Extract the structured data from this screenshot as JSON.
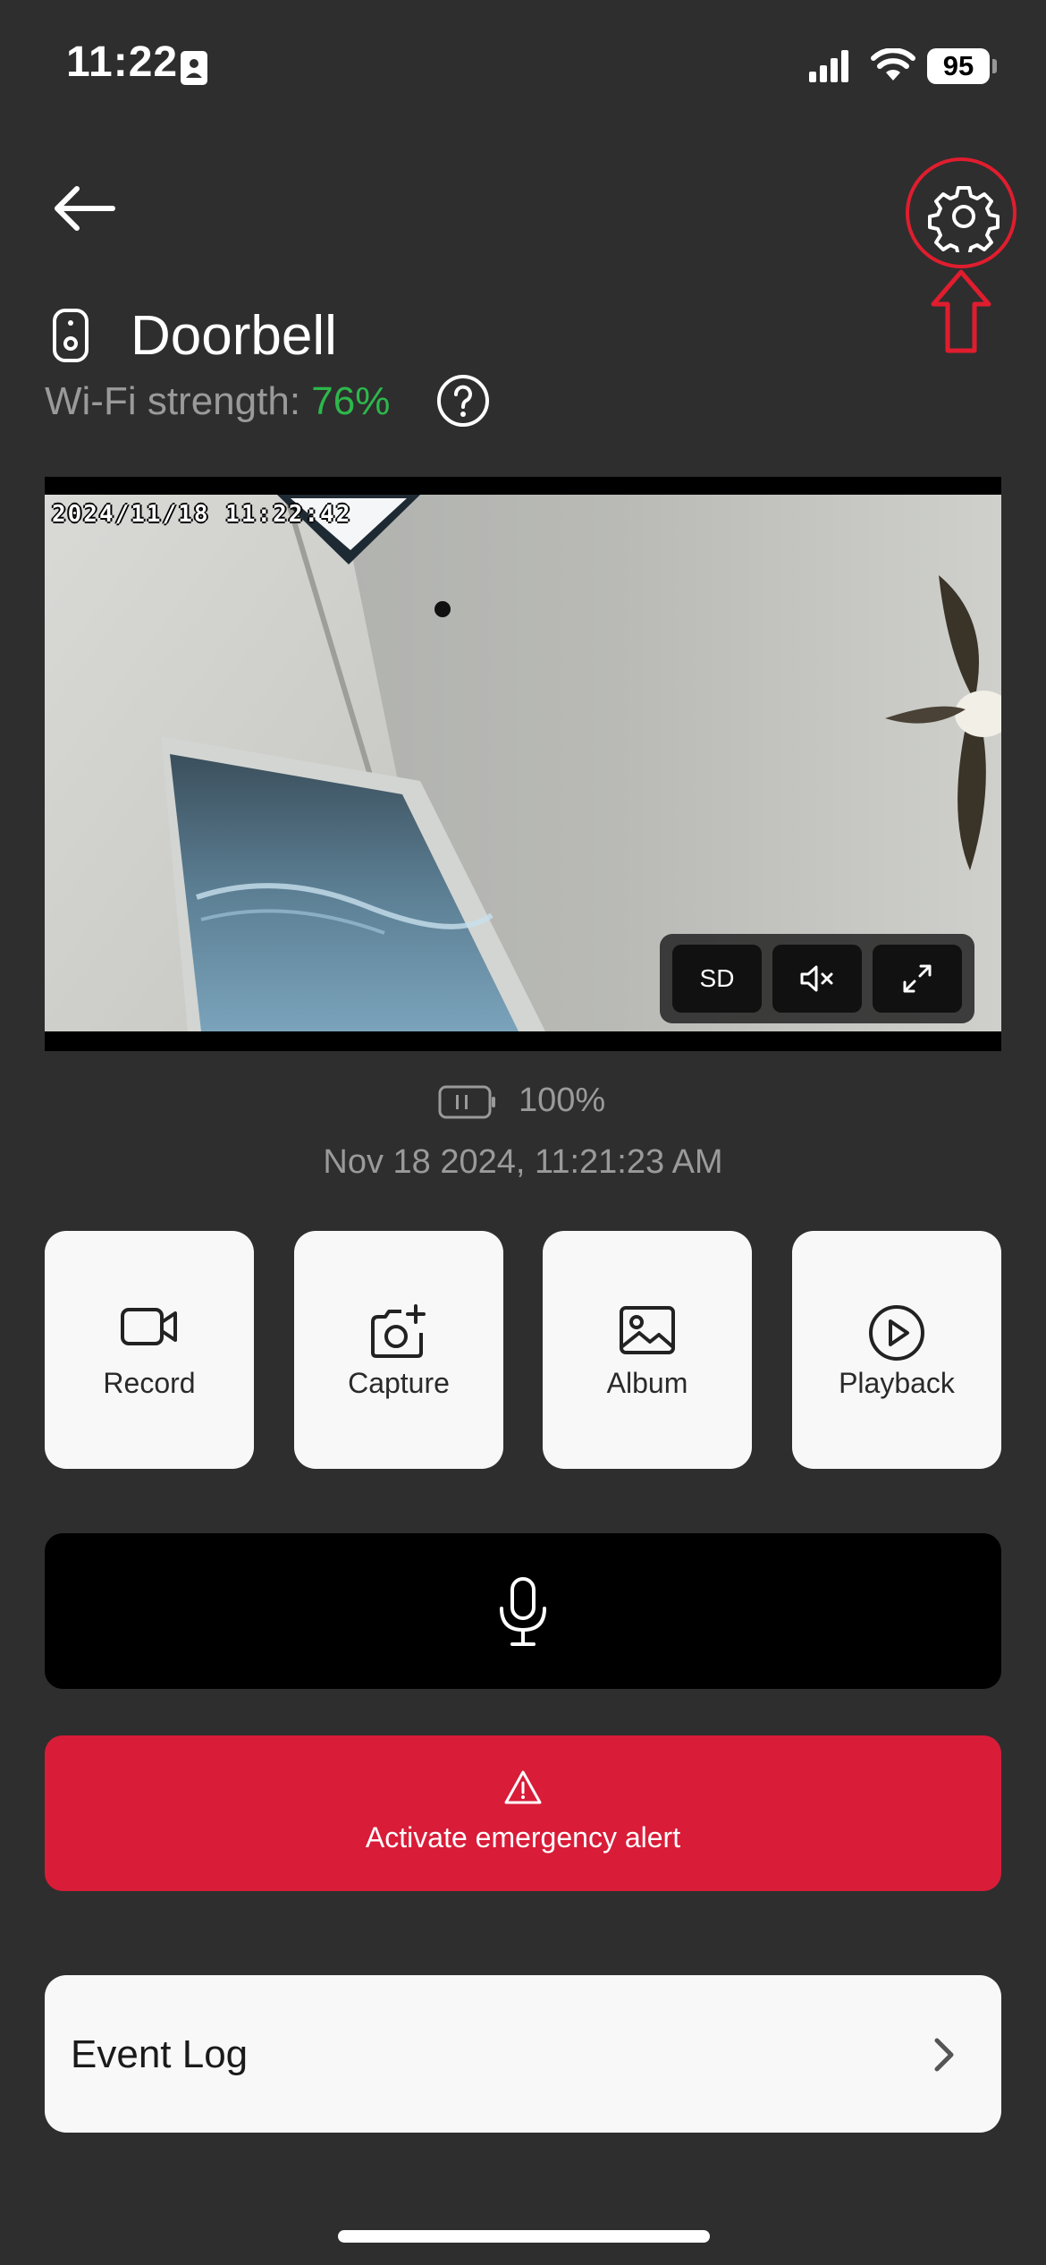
{
  "status_bar": {
    "time": "11:22",
    "battery": "95",
    "icons": [
      "contact-card-icon",
      "cellular-signal-icon",
      "wifi-icon",
      "battery-icon"
    ]
  },
  "header": {
    "back_icon": "arrow-left-icon",
    "settings_icon": "gear-icon",
    "highlight_color": "#e01d2e"
  },
  "device": {
    "name": "Doorbell",
    "icon": "doorbell-icon",
    "wifi_label": "Wi-Fi strength:",
    "wifi_value": "76%",
    "wifi_color": "#2db84b",
    "help_icon": "question-circle-icon"
  },
  "feed": {
    "timestamp": "2024/11/18 11:22:42",
    "controls": {
      "quality": "SD",
      "mute_icon": "speaker-muted-icon",
      "fullscreen_icon": "expand-icon"
    }
  },
  "device_battery": {
    "icon": "battery-icon",
    "value": "100%"
  },
  "last_updated": "Nov 18 2024, 11:21:23 AM",
  "actions": [
    {
      "label": "Record",
      "icon": "video-camera-icon"
    },
    {
      "label": "Capture",
      "icon": "camera-plus-icon"
    },
    {
      "label": "Album",
      "icon": "image-icon"
    },
    {
      "label": "Playback",
      "icon": "play-circle-icon"
    }
  ],
  "talk": {
    "icon": "microphone-icon"
  },
  "emergency": {
    "label": "Activate emergency alert",
    "icon": "warning-triangle-icon",
    "color": "#d91c38"
  },
  "event_log": {
    "label": "Event Log",
    "icon": "chevron-right-icon"
  }
}
